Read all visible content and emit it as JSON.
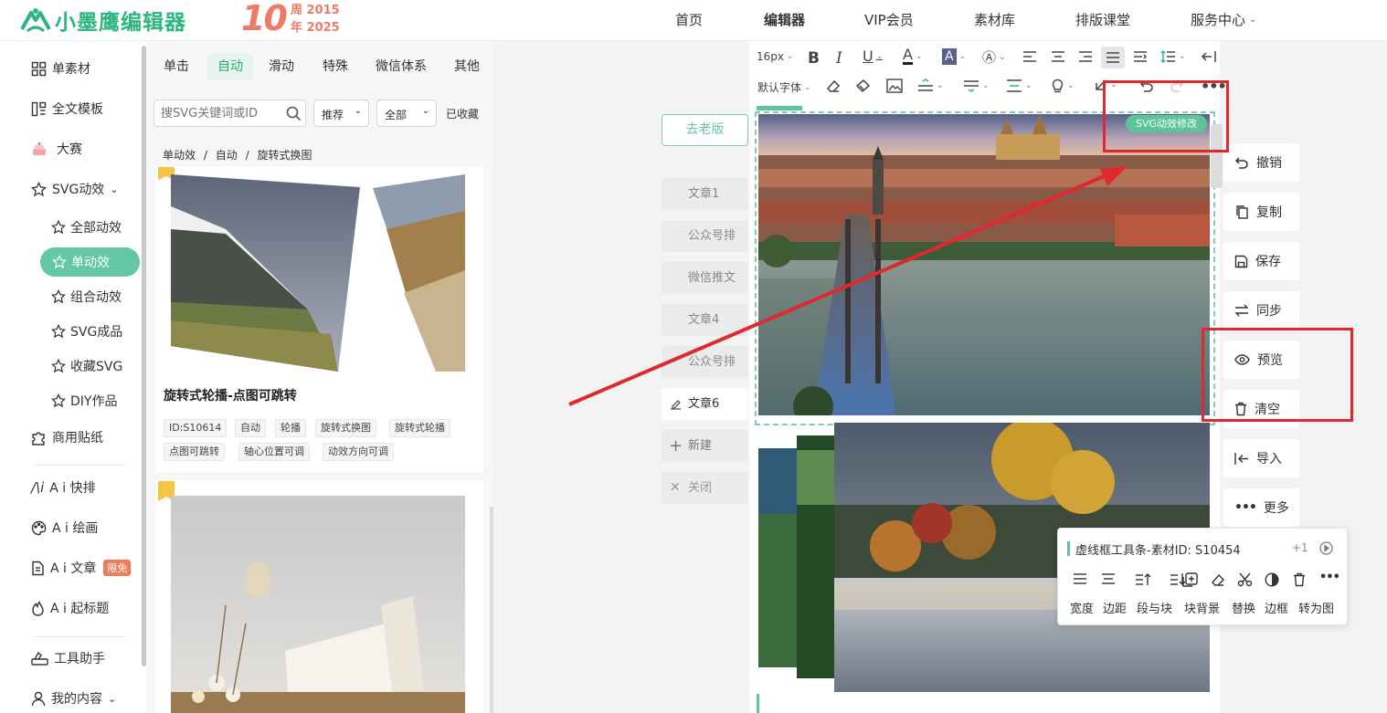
{
  "header": {
    "logo_text": "小墨鹰编辑器",
    "anniversary_number": "10",
    "anniversary_line1": "周 2015",
    "anniversary_line2": "年 2025",
    "nav": [
      "首页",
      "编辑器",
      "VIP会员",
      "素材库",
      "排版课堂",
      "服务中心"
    ]
  },
  "sidebar": {
    "items": [
      "单素材",
      "全文模板",
      "大赛",
      "SVG动效"
    ],
    "sub_items": [
      "全部动效",
      "单动效",
      "组合动效",
      "SVG成品",
      "收藏SVG",
      "DIY作品"
    ],
    "items2": [
      "商用贴纸",
      "A i 快排",
      "A i 绘画",
      "A i 文章",
      "A i 起标题",
      "工具助手",
      "我的内容"
    ],
    "free_badge": "限免"
  },
  "panel": {
    "tabs": [
      "单击",
      "自动",
      "滑动",
      "特殊",
      "微信体系",
      "其他"
    ],
    "search_placeholder": "搜SVG关键词或ID",
    "sort_label": "推荐",
    "filter_label": "全部",
    "favorited_label": "已收藏",
    "breadcrumb": [
      "单动效",
      "自动",
      "旋转式换图"
    ],
    "card1": {
      "title": "旋转式轮播-点图可跳转",
      "tags": [
        "ID:S10614",
        "自动",
        "轮播",
        "旋转式换图",
        "旋转式轮播",
        "点图可跳转",
        "轴心位置可调",
        "动效方向可调"
      ]
    }
  },
  "articles": {
    "old_version": "去老版",
    "items": [
      "文章1",
      "公众号排",
      "微信推文",
      "文章4",
      "公众号排",
      "文章6"
    ],
    "new_label": "新建",
    "close_label": "关闭"
  },
  "editor": {
    "font_size": "16px",
    "default_font": "默认字体",
    "svg_badge": "SVG动效修改"
  },
  "actions": [
    "撤销",
    "复制",
    "保存",
    "同步",
    "预览",
    "清空",
    "导入",
    "更多"
  ],
  "popup": {
    "title": "虚线框工具条-素材ID: S10454",
    "count": "+1",
    "tools": [
      "宽度",
      "边距",
      "段与块",
      "块背景",
      "替换",
      "边框",
      "转为图"
    ]
  },
  "colors": {
    "brand": "#2bb57f",
    "accent_active": "#63c8a3",
    "anniversary": "#f07a66",
    "highlight_red": "#e0282d"
  }
}
